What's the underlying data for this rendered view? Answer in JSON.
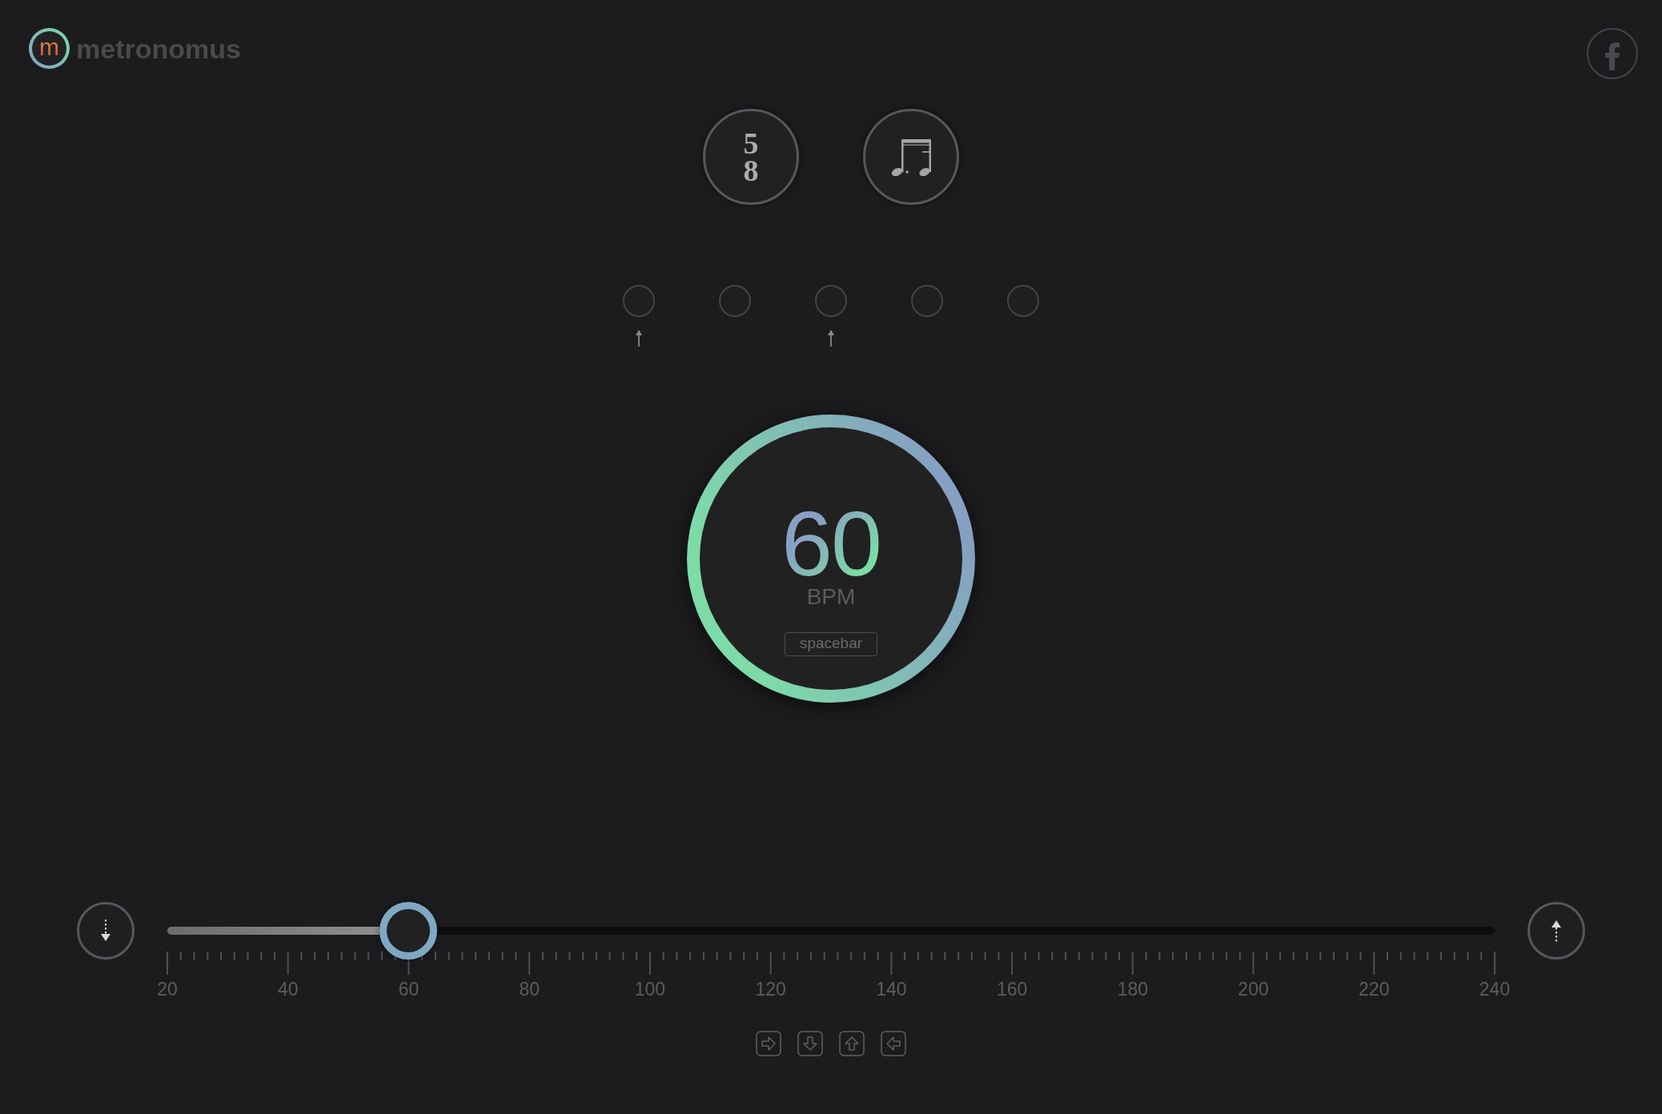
{
  "header": {
    "logo_mark": "m",
    "app_name": "metronomus"
  },
  "time_signature": {
    "numerator": "5",
    "denominator": "8"
  },
  "beats": [
    {
      "accented": true
    },
    {
      "accented": false
    },
    {
      "accented": true
    },
    {
      "accented": false
    },
    {
      "accented": false
    }
  ],
  "tempo": {
    "value": "60",
    "unit": "BPM",
    "key_hint": "spacebar"
  },
  "slider": {
    "level": 0.1818,
    "scale": [
      "20",
      "40",
      "60",
      "80",
      "100",
      "120",
      "140",
      "160",
      "180",
      "200",
      "220",
      "240"
    ]
  },
  "keyboard_keys": [
    {
      "kind": "right"
    },
    {
      "kind": "down"
    },
    {
      "kind": "up"
    },
    {
      "kind": "left"
    }
  ]
}
